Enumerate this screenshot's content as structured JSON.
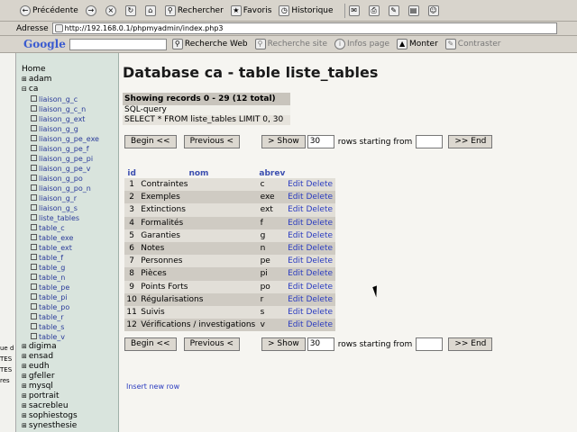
{
  "browser": {
    "toolbar": {
      "back": "Précédente",
      "search": "Rechercher",
      "favorites": "Favoris",
      "history": "Historique"
    },
    "address": {
      "label": "Adresse",
      "url": "http://192.168.0.1/phpmyadmin/index.php3"
    },
    "google_bar": {
      "brand": "Google",
      "web_search": "Recherche Web",
      "site_search": "Recherche site",
      "page_info": "Infos page",
      "up": "Monter",
      "contrast": "Contraster"
    }
  },
  "left_strip": [
    "ue d",
    "TES",
    "TES",
    "res"
  ],
  "sidebar": {
    "home": "Home",
    "databases_top": [
      "adam"
    ],
    "current_db": "ca",
    "tables": [
      "liaison_g_c",
      "liaison_g_c_n",
      "liaison_g_ext",
      "liaison_g_g",
      "liaison_g_pe_exe",
      "liaison_g_pe_f",
      "liaison_g_pe_pi",
      "liaison_g_pe_v",
      "liaison_g_po",
      "liaison_g_po_n",
      "liaison_g_r",
      "liaison_g_s",
      "liste_tables",
      "table_c",
      "table_exe",
      "table_ext",
      "table_f",
      "table_g",
      "table_n",
      "table_pe",
      "table_pi",
      "table_po",
      "table_r",
      "table_s",
      "table_v"
    ],
    "databases_bottom": [
      "digima",
      "ensad",
      "eudh",
      "gfeller",
      "mysql",
      "portrait",
      "sacrebleu",
      "sophiestogs",
      "synesthesie"
    ]
  },
  "main": {
    "title": "Database ca - table liste_tables",
    "records_info": "Showing records 0 - 29 (12 total)",
    "sql_label": "SQL-query",
    "sql_query": "SELECT * FROM liste_tables LIMIT 0, 30",
    "nav": {
      "begin": "Begin <<",
      "previous": "Previous <",
      "show": "> Show",
      "show_count": "30",
      "rows_text": "rows starting from",
      "end": ">> End"
    },
    "columns": [
      "id",
      "nom",
      "abrev"
    ],
    "rows": [
      {
        "id": "1",
        "nom": "Contraintes",
        "abrev": "c"
      },
      {
        "id": "2",
        "nom": "Exemples",
        "abrev": "exe"
      },
      {
        "id": "3",
        "nom": "Extinctions",
        "abrev": "ext"
      },
      {
        "id": "4",
        "nom": "Formalités",
        "abrev": "f"
      },
      {
        "id": "5",
        "nom": "Garanties",
        "abrev": "g"
      },
      {
        "id": "6",
        "nom": "Notes",
        "abrev": "n"
      },
      {
        "id": "7",
        "nom": "Personnes",
        "abrev": "pe"
      },
      {
        "id": "8",
        "nom": "Pièces",
        "abrev": "pi"
      },
      {
        "id": "9",
        "nom": "Points Forts",
        "abrev": "po"
      },
      {
        "id": "10",
        "nom": "Régularisations",
        "abrev": "r"
      },
      {
        "id": "11",
        "nom": "Suivis",
        "abrev": "s"
      },
      {
        "id": "12",
        "nom": "Vérifications / investigations",
        "abrev": "v"
      }
    ],
    "edit_label": "Edit",
    "delete_label": "Delete",
    "insert_new_row": "Insert new row"
  }
}
